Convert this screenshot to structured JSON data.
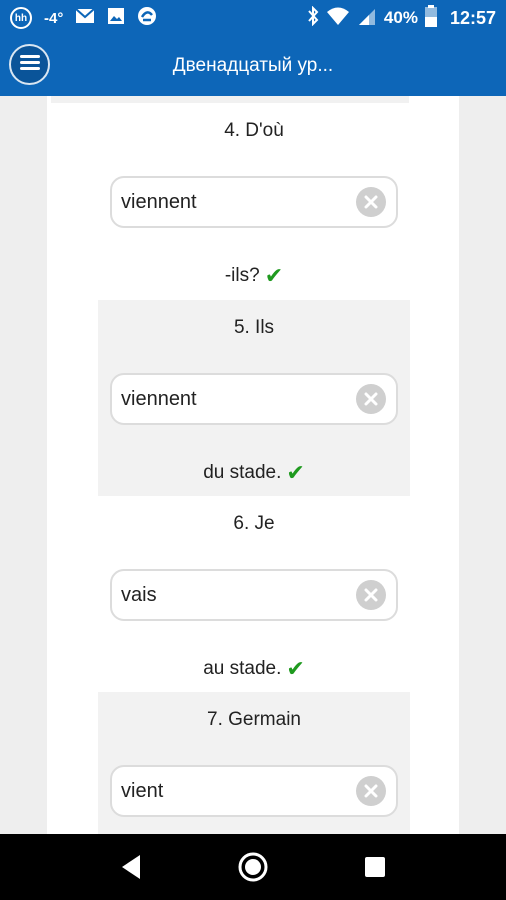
{
  "status_bar": {
    "badge": "hh",
    "temperature": "-4°",
    "battery_percent": "40%",
    "time": "12:57"
  },
  "app_bar": {
    "title": "Двенадцатый ур..."
  },
  "exercises": [
    {
      "prompt": "4. D'où",
      "answer": "viennent",
      "suffix": "-ils?",
      "correct": true,
      "check": "✔"
    },
    {
      "prompt": "5. Ils",
      "answer": "viennent",
      "suffix": "du stade.",
      "correct": true,
      "check": "✔"
    },
    {
      "prompt": "6. Je",
      "answer": "vais",
      "suffix": "au stade.",
      "correct": true,
      "check": "✔"
    },
    {
      "prompt": "7. Germain",
      "answer": "vient",
      "suffix": "",
      "correct": null,
      "check": ""
    }
  ],
  "icons": {
    "menu": "menu-icon",
    "clear": "clear-icon",
    "check": "check-icon",
    "back": "back-icon",
    "home": "home-icon",
    "recents": "recents-icon"
  },
  "colors": {
    "primary": "#0d66b8",
    "check": "#1f9a1f",
    "shaded_block": "#f2f2f2"
  }
}
